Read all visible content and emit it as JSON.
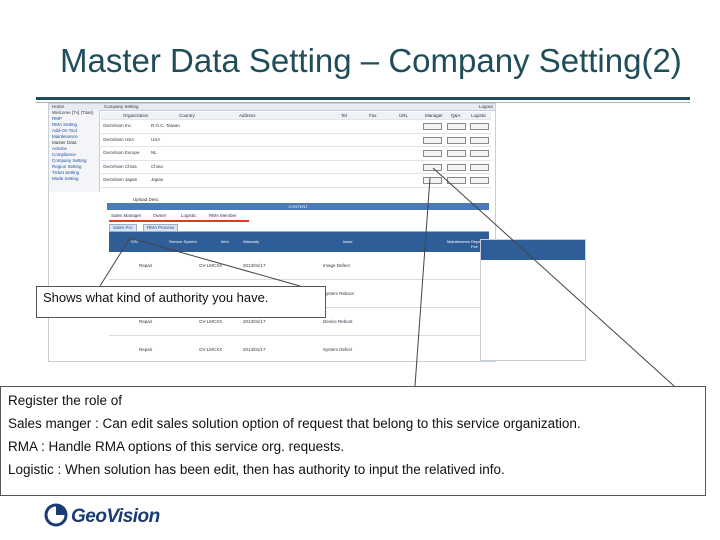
{
  "title": "Master Data Setting – Company Setting(2)",
  "screenshot": {
    "topbar_left": "Home",
    "topbar_center": "Company Setting",
    "topbar_right": "Logout",
    "sidebar": [
      "Welcome [Tv] (Titan)",
      "RMP",
      "RMA Setting",
      "Add-On Tool",
      "Maintenance",
      "Master Data",
      "Actions",
      "Compliance",
      "Company Setting",
      "Region Setting",
      "Ticket Setting",
      "Mode Setting"
    ],
    "table_headers": [
      "Organization",
      "Country",
      "Address",
      "Tel",
      "Fax",
      "URL",
      "Manager",
      "Q&A",
      "Logistic"
    ],
    "table_rows": [
      {
        "org": "GeoVision Inc.",
        "country": "R.O.C. Taiwan"
      },
      {
        "org": "GeoVision USA",
        "country": "USA"
      },
      {
        "org": "GeoVision Europe",
        "country": "NL"
      },
      {
        "org": "GeoVision China",
        "country": "China"
      },
      {
        "org": "GeoVision Japan",
        "country": "Japan"
      }
    ],
    "row_button_labels": [
      "Register",
      "Register",
      "Register"
    ],
    "upload_label": "Upload Desc",
    "content_bar": "CONTENT",
    "role_checks": [
      "Sales Manager",
      "Owner",
      "Logistic",
      "RMA Member"
    ],
    "sub_tabs": [
      "Sales Pro",
      "RMA Process"
    ],
    "grid_headers": [
      "S/N",
      "Service System",
      "Item",
      "Warranty",
      "Issue",
      "Maintenance",
      "Repair Fee"
    ],
    "grid_rows": [
      {
        "type": "Repair",
        "model": "GV-LMCXX",
        "date": "2013/01/17",
        "issue": "Image Defect"
      },
      {
        "type": "Repair",
        "model": "GV-LMCXX",
        "date": "2013/01/17",
        "issue": "System Reboot"
      },
      {
        "type": "Repair",
        "model": "GV-LMCXX",
        "date": "2013/01/17",
        "issue": "Device Reboot"
      },
      {
        "type": "Repair",
        "model": "GV-LMCXX",
        "date": "2013/01/17",
        "issue": "System Defect"
      }
    ]
  },
  "callout_authority": "Shows what kind of authority you have.",
  "callout_roles": [
    "Register the role of",
    "Sales manger : Can edit sales solution option of request that belong to this service organization.",
    "RMA : Handle RMA options of this service org. requests.",
    "Logistic : When solution has been edit, then has authority to input the relatived info."
  ],
  "logo_text": "GeoVision",
  "colors": {
    "title": "#1f4e5a",
    "header_blue": "#2f5d97",
    "logo_blue": "#1a3b73",
    "accent_red": "#e03a2a"
  }
}
